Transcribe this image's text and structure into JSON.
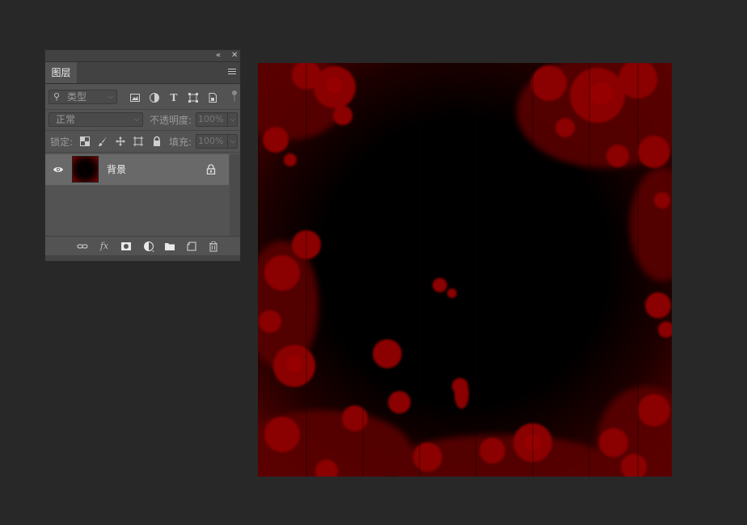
{
  "panel": {
    "collapse_icon": "double-left-chevron-icon",
    "close_icon": "close-icon",
    "tab_label": "图层",
    "menu_icon": "hamburger-menu-icon",
    "filter": {
      "search_icon": "search-icon",
      "kind_value": "类型",
      "filter_icons": [
        "image-filter-icon",
        "adjustment-filter-icon",
        "type-filter-icon",
        "shape-filter-icon",
        "smart-object-filter-icon"
      ]
    },
    "blend_mode": "正常",
    "opacity_label": "不透明度:",
    "opacity_value": "100%",
    "lock_label": "锁定:",
    "lock_icons": [
      "lock-transparent-icon",
      "lock-pixels-icon",
      "lock-position-icon",
      "lock-artboard-icon",
      "lock-all-icon"
    ],
    "fill_label": "填充:",
    "fill_value": "100%",
    "layers": [
      {
        "name": "背景",
        "visible": true,
        "locked": true
      }
    ],
    "footer_icons": [
      "link-layers-icon",
      "fx-icon",
      "mask-icon",
      "adjustment-layer-icon",
      "group-folder-icon",
      "new-layer-icon",
      "trash-icon"
    ]
  },
  "colors": {
    "app_background": "#282828",
    "panel_background": "#535353",
    "selected_layer": "#696969",
    "canvas_red": "#8b0000"
  }
}
